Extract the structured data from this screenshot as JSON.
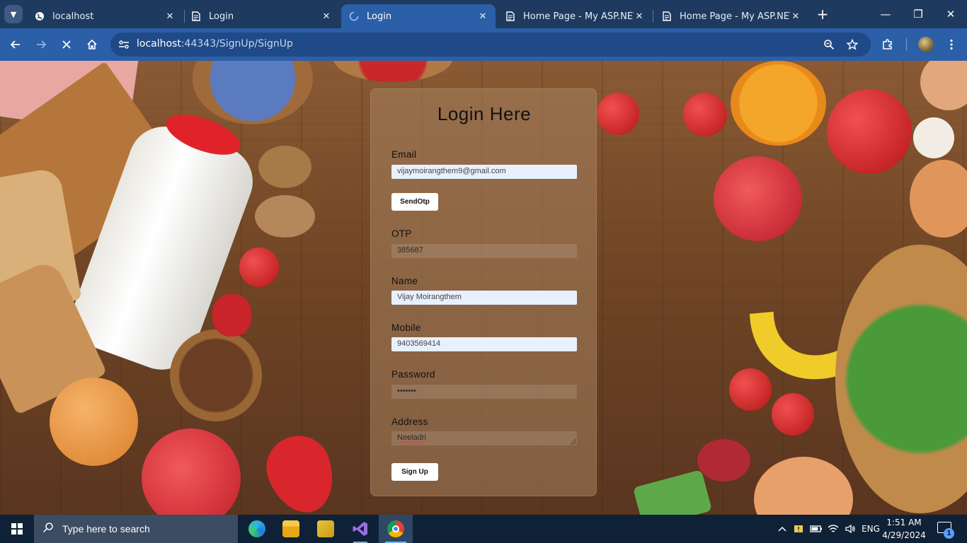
{
  "browser": {
    "tabs": [
      {
        "title": "localhost",
        "icon": "globe-icon",
        "active": false
      },
      {
        "title": "Login",
        "icon": "page-icon",
        "active": false
      },
      {
        "title": "Login",
        "icon": "loading-spinner-icon",
        "active": true
      },
      {
        "title": "Home Page - My ASP.NET Ap",
        "icon": "page-icon",
        "active": false
      },
      {
        "title": "Home Page - My ASP.NET Ap",
        "icon": "page-icon",
        "active": false
      }
    ],
    "url": {
      "host": "localhost",
      "rest": ":44343/SignUp/SignUp"
    }
  },
  "form": {
    "title": "Login Here",
    "email_label": "Email",
    "email_value": "vijaymoirangthem9@gmail.com",
    "send_otp_label": "SendOtp",
    "otp_label": "OTP",
    "otp_value": "385687",
    "name_label": "Name",
    "name_value": "Vijay Moirangthem",
    "mobile_label": "Mobile",
    "mobile_value": "9403569414",
    "password_label": "Password",
    "password_value": "•••••••",
    "address_label": "Address",
    "address_value": "Neeladri",
    "signup_label": "Sign Up"
  },
  "taskbar": {
    "search_placeholder": "Type here to search",
    "language": "ENG",
    "time": "1:51 AM",
    "date": "4/29/2024",
    "notification_count": "1"
  },
  "colors": {
    "tab_bar": "#1e3a5f",
    "toolbar": "#2b5fa8",
    "autofill_bg": "#e8f0fe",
    "taskbar": "#0f2136"
  }
}
